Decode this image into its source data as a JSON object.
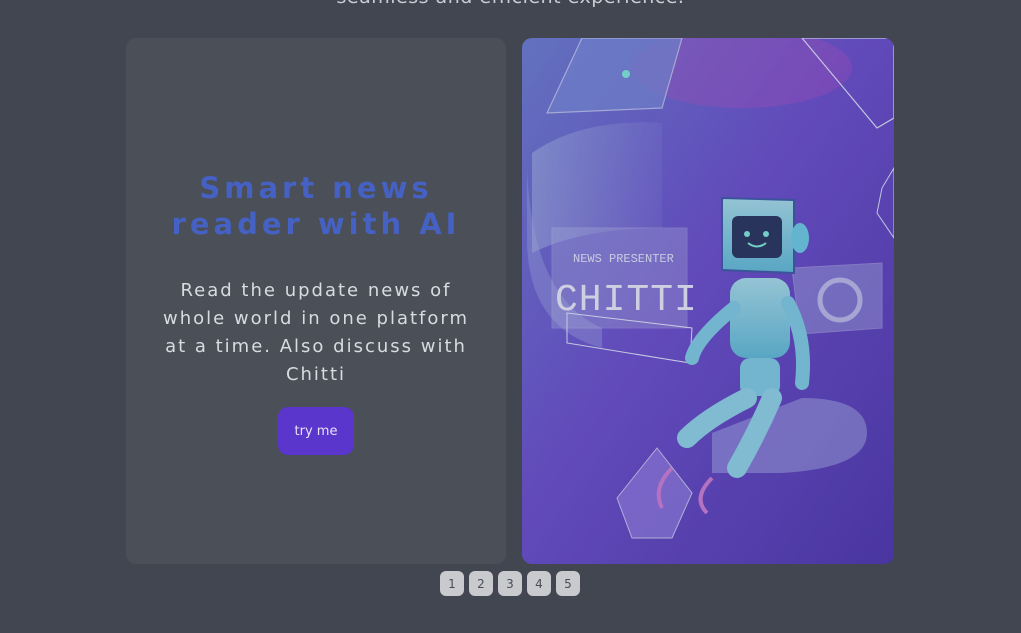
{
  "intro_text": "seamless and efficient experience.",
  "hero": {
    "title": "Smart news reader with AI",
    "description": "Read the update news of whole world in one platform at a time. Also discuss with Chitti",
    "cta_label": "try me"
  },
  "illustration": {
    "subtitle": "NEWS PRESENTER",
    "name": "CHITTI"
  },
  "pagination": [
    "1",
    "2",
    "3",
    "4",
    "5"
  ],
  "colors": {
    "background": "#424650",
    "card": "#4b4f58",
    "title": "#4561c4",
    "cta": "#5b36cc",
    "illustration_bg": "#5b45c6"
  }
}
